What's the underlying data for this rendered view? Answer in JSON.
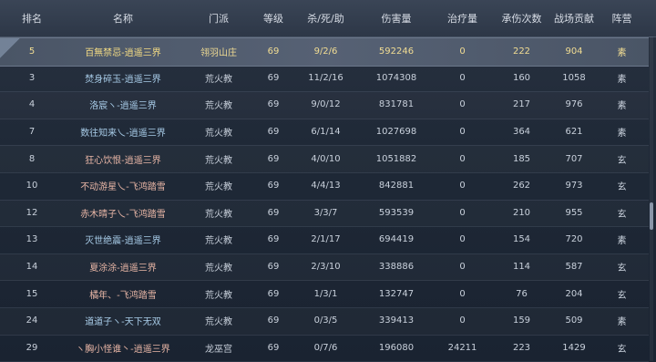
{
  "headers": [
    "排名",
    "名称",
    "门派",
    "等级",
    "杀/死/助",
    "伤害量",
    "治疗量",
    "承伤次数",
    "战场贡献",
    "阵营"
  ],
  "rows": [
    {
      "rank": "5",
      "name": "百無禁忌-逍遥三界",
      "sect": "翎羽山庄",
      "level": "69",
      "kda": "9/2/6",
      "damage": "592246",
      "heal": "0",
      "hits": "222",
      "contrib": "904",
      "camp": "素"
    },
    {
      "rank": "3",
      "name": "焚身碎玉-逍遥三界",
      "sect": "荒火教",
      "level": "69",
      "kda": "11/2/16",
      "damage": "1074308",
      "heal": "0",
      "hits": "160",
      "contrib": "1058",
      "camp": "素"
    },
    {
      "rank": "4",
      "name": "洛宸ヽ-逍遥三界",
      "sect": "荒火教",
      "level": "69",
      "kda": "9/0/12",
      "damage": "831781",
      "heal": "0",
      "hits": "217",
      "contrib": "976",
      "camp": "素"
    },
    {
      "rank": "7",
      "name": "数往知来乀-逍遥三界",
      "sect": "荒火教",
      "level": "69",
      "kda": "6/1/14",
      "damage": "1027698",
      "heal": "0",
      "hits": "364",
      "contrib": "621",
      "camp": "素"
    },
    {
      "rank": "8",
      "name": "狂心饮恨-逍遥三界",
      "sect": "荒火教",
      "level": "69",
      "kda": "4/0/10",
      "damage": "1051882",
      "heal": "0",
      "hits": "185",
      "contrib": "707",
      "camp": "玄"
    },
    {
      "rank": "10",
      "name": "不动游星乀-飞鸿踏雪",
      "sect": "荒火教",
      "level": "69",
      "kda": "4/4/13",
      "damage": "842881",
      "heal": "0",
      "hits": "262",
      "contrib": "973",
      "camp": "玄"
    },
    {
      "rank": "12",
      "name": "赤木晴子乀-飞鸿踏雪",
      "sect": "荒火教",
      "level": "69",
      "kda": "3/3/7",
      "damage": "593539",
      "heal": "0",
      "hits": "210",
      "contrib": "955",
      "camp": "玄"
    },
    {
      "rank": "13",
      "name": "灭世绝震-逍遥三界",
      "sect": "荒火教",
      "level": "69",
      "kda": "2/1/17",
      "damage": "694419",
      "heal": "0",
      "hits": "154",
      "contrib": "720",
      "camp": "素"
    },
    {
      "rank": "14",
      "name": "夏涂涂-逍遥三界",
      "sect": "荒火教",
      "level": "69",
      "kda": "2/3/10",
      "damage": "338886",
      "heal": "0",
      "hits": "114",
      "contrib": "587",
      "camp": "玄"
    },
    {
      "rank": "15",
      "name": "橘年、-飞鸿踏雪",
      "sect": "荒火教",
      "level": "69",
      "kda": "1/3/1",
      "damage": "132747",
      "heal": "0",
      "hits": "76",
      "contrib": "204",
      "camp": "玄"
    },
    {
      "rank": "24",
      "name": "道道子ヽ-天下无双",
      "sect": "荒火教",
      "level": "69",
      "kda": "0/3/5",
      "damage": "339413",
      "heal": "0",
      "hits": "159",
      "contrib": "509",
      "camp": "素"
    },
    {
      "rank": "29",
      "name": "ヽ胸小怪谁丶-逍遥三界",
      "sect": "龙巫宫",
      "level": "69",
      "kda": "0/7/6",
      "damage": "196080",
      "heal": "24211",
      "hits": "223",
      "contrib": "1429",
      "camp": "玄"
    }
  ],
  "colors": {
    "su": "#a8cce8",
    "xuan": "#e8b6a6",
    "highlight_text": "#f6dd84"
  }
}
